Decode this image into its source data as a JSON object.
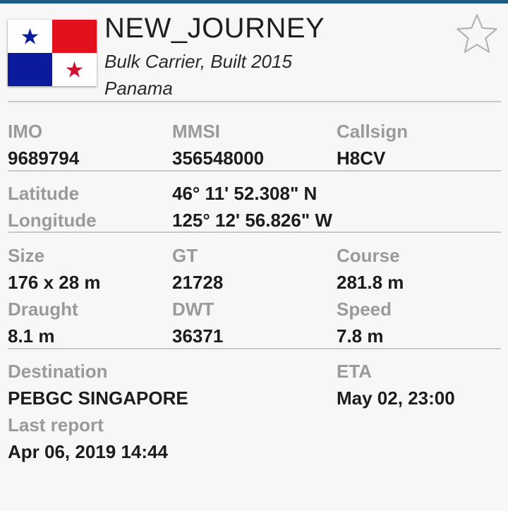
{
  "vessel": {
    "name": "NEW_JOURNEY",
    "type_built": "Bulk Carrier, Built 2015",
    "flag_country": "Panama",
    "flag_icon": "panama-flag-icon",
    "favorite_icon": "star-outline-icon"
  },
  "ids": {
    "imo_label": "IMO",
    "imo_value": "9689794",
    "mmsi_label": "MMSI",
    "mmsi_value": "356548000",
    "callsign_label": "Callsign",
    "callsign_value": "H8CV"
  },
  "position": {
    "latitude_label": "Latitude",
    "latitude_value": "46° 11' 52.308\" N",
    "longitude_label": "Longitude",
    "longitude_value": "125° 12' 56.826\" W"
  },
  "dimensions": {
    "size_label": "Size",
    "size_value": "176 x 28 m",
    "gt_label": "GT",
    "gt_value": "21728",
    "course_label": "Course",
    "course_value": "281.8 m",
    "draught_label": "Draught",
    "draught_value": "8.1 m",
    "dwt_label": "DWT",
    "dwt_value": "36371",
    "speed_label": "Speed",
    "speed_value": "7.8 m"
  },
  "voyage": {
    "destination_label": "Destination",
    "destination_value": "PEBGC SINGAPORE",
    "eta_label": "ETA",
    "eta_value": "May 02, 23:00",
    "last_report_label": "Last report",
    "last_report_value": "Apr 06, 2019 14:44"
  },
  "colors": {
    "topbar": "#1f5a86",
    "flag_red": "#d21034",
    "flag_blue": "#0c1a9e",
    "label_gray": "#9a9a9a",
    "value_dark": "#1c1c1c"
  }
}
